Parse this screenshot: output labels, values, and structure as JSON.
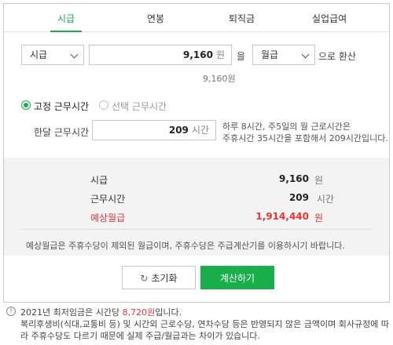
{
  "tabs": [
    {
      "label": "시급"
    },
    {
      "label": "연봉"
    },
    {
      "label": "퇴직금"
    },
    {
      "label": "실업급여"
    }
  ],
  "converter": {
    "from_select": "시급",
    "amount_value": "9,160",
    "amount_unit": "원",
    "particle": "을",
    "to_select": "월급",
    "suffix": "으로 환산",
    "amount_readout": "9,160원"
  },
  "work_time": {
    "radio_fixed": "고정 근무시간",
    "radio_select": "선택 근무시간",
    "monthly_label": "한달 근무시간",
    "hours_value": "209",
    "hours_unit": "시간",
    "help_line1": "하루 8시간, 주5일의 월 근로시간은",
    "help_line2": "주휴시간 35시간을 포함해서 209시간입니다."
  },
  "results": {
    "rows": [
      {
        "label": "시급",
        "value": "9,160",
        "unit": "원"
      },
      {
        "label": "근무시간",
        "value": "209",
        "unit": "시간"
      },
      {
        "label": "예상월급",
        "value": "1,914,440",
        "unit": "원"
      }
    ],
    "note": "예상월급은 주휴수당이 제외된 월급이며, 주휴수당은 주급계산기를 이용하시기 바랍니다."
  },
  "buttons": {
    "reset": "초기화",
    "calculate": "계산하기"
  },
  "notes": {
    "line1_prefix": "2021년 최저임금은 시간당 ",
    "line1_highlight": "8,720원",
    "line1_suffix": "입니다.",
    "line2": "복리후생비(식대,교통비 등) 및 시간외 근로수당, 연차수당 등은 반영되지 않은 금액이며 회사규정에 따",
    "line3": "라 주휴수당도 다르기 때문에 실제 주급/월급과는 차이가 있습니다."
  },
  "colors": {
    "accent": "#19b04b",
    "highlight_red": "#e5363b"
  }
}
